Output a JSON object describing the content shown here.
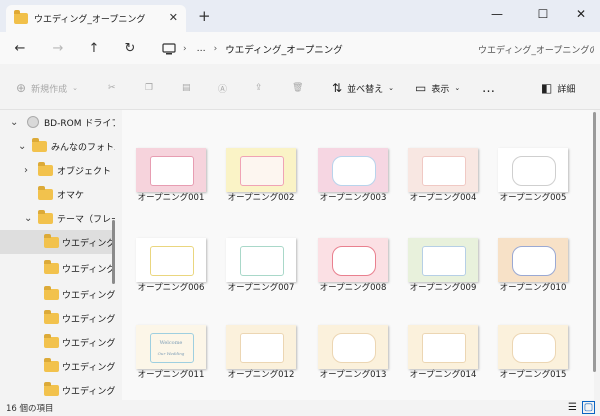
{
  "window": {
    "tab_title": "ウエディング_オープニング",
    "tab_close": "✕",
    "new_tab": "+",
    "minimize": "—",
    "maximize": "☐",
    "close": "✕"
  },
  "nav": {
    "back": "←",
    "forward": "→",
    "up": "↑",
    "refresh": "↻",
    "more": "…",
    "breadcrumb_sep": "›",
    "address": "ウエディング_オープニング",
    "search_placeholder": "ウエディング_オープニングの検"
  },
  "toolbar": {
    "new": "新規作成",
    "sort": "並べ替え",
    "view": "表示",
    "more": "…",
    "details": "詳細"
  },
  "sidebar": {
    "items": [
      {
        "label": "BD-ROM ドライブ"
      },
      {
        "label": "みんなのフォトム"
      },
      {
        "label": "オブジェクト"
      },
      {
        "label": "オマケ"
      },
      {
        "label": "テーマ（フレー"
      },
      {
        "label": "ウエディング_"
      },
      {
        "label": "ウエディング_"
      },
      {
        "label": "ウエディング_"
      },
      {
        "label": "ウエディング_"
      },
      {
        "label": "ウエディング_"
      },
      {
        "label": "ウエディング_"
      },
      {
        "label": "ウエディング_"
      }
    ]
  },
  "files": [
    {
      "name": "オープニング001",
      "bg": "#f6d3dc",
      "frame": "#ffffff",
      "accent": "#e79db2"
    },
    {
      "name": "オープニング002",
      "bg": "#faf3c6",
      "frame": "#fdf6f0",
      "accent": "#f0a3b5"
    },
    {
      "name": "オープニング003",
      "bg": "#f6d6e2",
      "frame": "#ffffff",
      "accent": "#b8d4ec"
    },
    {
      "name": "オープニング004",
      "bg": "#f8e7e2",
      "frame": "#ffffff",
      "accent": "#f0c9c4"
    },
    {
      "name": "オープニング005",
      "bg": "#ffffff",
      "frame": "#ffffff",
      "accent": "#cfcfcf"
    },
    {
      "name": "オープニング006",
      "bg": "#ffffff",
      "frame": "#ffffff",
      "accent": "#ead67f"
    },
    {
      "name": "オープニング007",
      "bg": "#ffffff",
      "frame": "#ffffff",
      "accent": "#a9d8c9"
    },
    {
      "name": "オープニング008",
      "bg": "#fbe0e4",
      "frame": "#ffffff",
      "accent": "#e9808f"
    },
    {
      "name": "オープニング009",
      "bg": "#e8f1dc",
      "frame": "#ffffff",
      "accent": "#b6cfe6"
    },
    {
      "name": "オープニング010",
      "bg": "#f7e1c7",
      "frame": "#ffffff",
      "accent": "#9aa9d4"
    },
    {
      "name": "オープニング011",
      "bg": "#fcf6e8",
      "frame": "#fcf6e8",
      "accent": "#9ecfe0",
      "text1": "Welcome",
      "text2": "Our Wedding"
    },
    {
      "name": "オープニング012",
      "bg": "#fbf1dc",
      "frame": "#ffffff",
      "accent": "#ecd6b3"
    },
    {
      "name": "オープニング013",
      "bg": "#fbf1dc",
      "frame": "#ffffff",
      "accent": "#ecd6b3"
    },
    {
      "name": "オープニング014",
      "bg": "#fbf1dc",
      "frame": "#ffffff",
      "accent": "#ecd6b3"
    },
    {
      "name": "オープニング015",
      "bg": "#fbf1dc",
      "frame": "#ffffff",
      "accent": "#ecd6b3"
    }
  ],
  "status": {
    "count": "16 個の項目"
  }
}
